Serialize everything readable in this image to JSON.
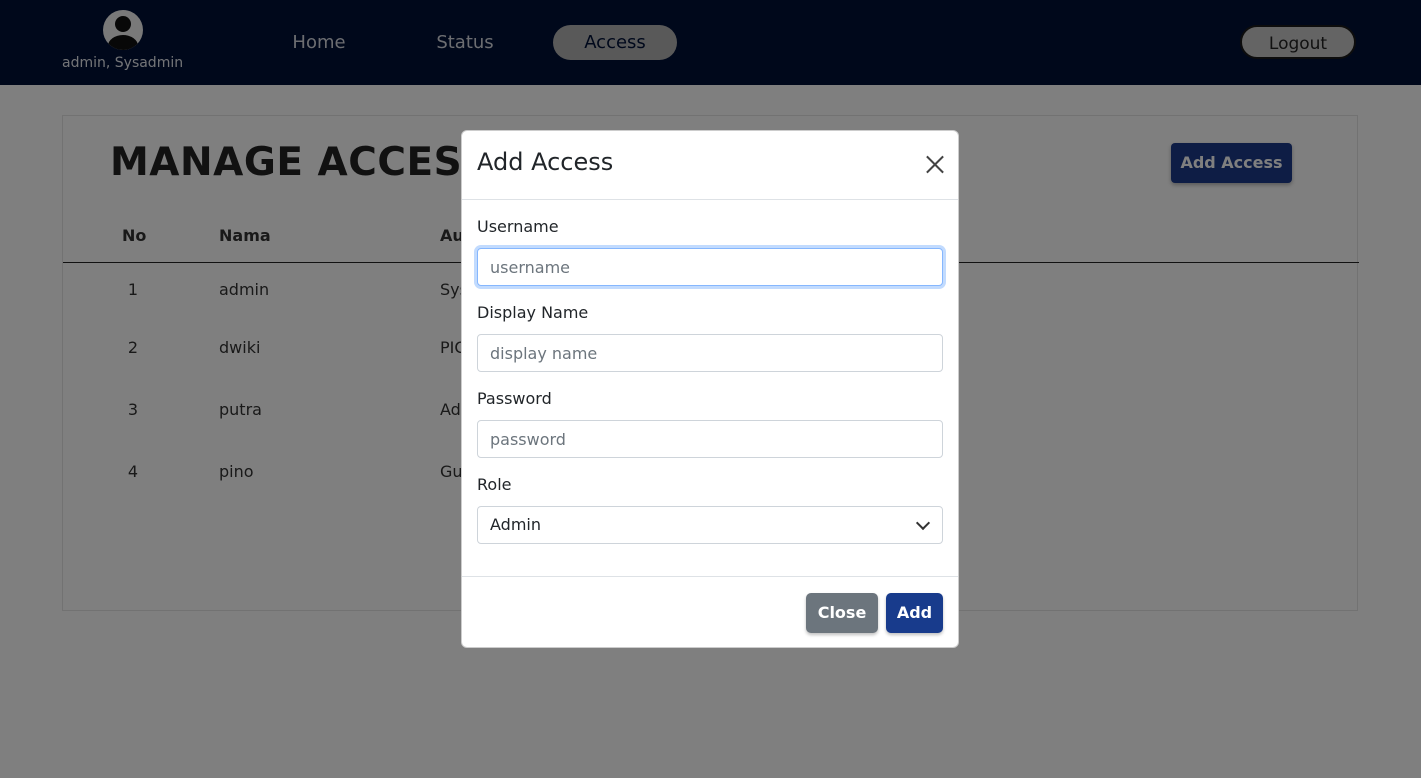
{
  "navbar": {
    "user_label": "admin, Sysadmin",
    "links": [
      {
        "label": "Home",
        "active": false
      },
      {
        "label": "Status",
        "active": false
      },
      {
        "label": "Access",
        "active": true
      }
    ],
    "logout_label": "Logout",
    "background_color": "#001137"
  },
  "page": {
    "title": "MANAGE ACCESS",
    "add_button_label": "Add Access",
    "table": {
      "columns": [
        "No",
        "Nama",
        "Au"
      ],
      "rows": [
        {
          "no": "1",
          "nama": "admin",
          "role": "Sys"
        },
        {
          "no": "2",
          "nama": "dwiki",
          "role": "PIC"
        },
        {
          "no": "3",
          "nama": "putra",
          "role": "Ad"
        },
        {
          "no": "4",
          "nama": "pino",
          "role": "Gu"
        }
      ]
    }
  },
  "modal": {
    "title": "Add Access",
    "fields": {
      "username": {
        "label": "Username",
        "placeholder": "username",
        "value": ""
      },
      "display_name": {
        "label": "Display Name",
        "placeholder": "display name",
        "value": ""
      },
      "password": {
        "label": "Password",
        "placeholder": "password",
        "value": ""
      },
      "role": {
        "label": "Role",
        "selected": "Admin"
      }
    },
    "close_label": "Close",
    "add_label": "Add",
    "accent_color": "#183b8c"
  }
}
